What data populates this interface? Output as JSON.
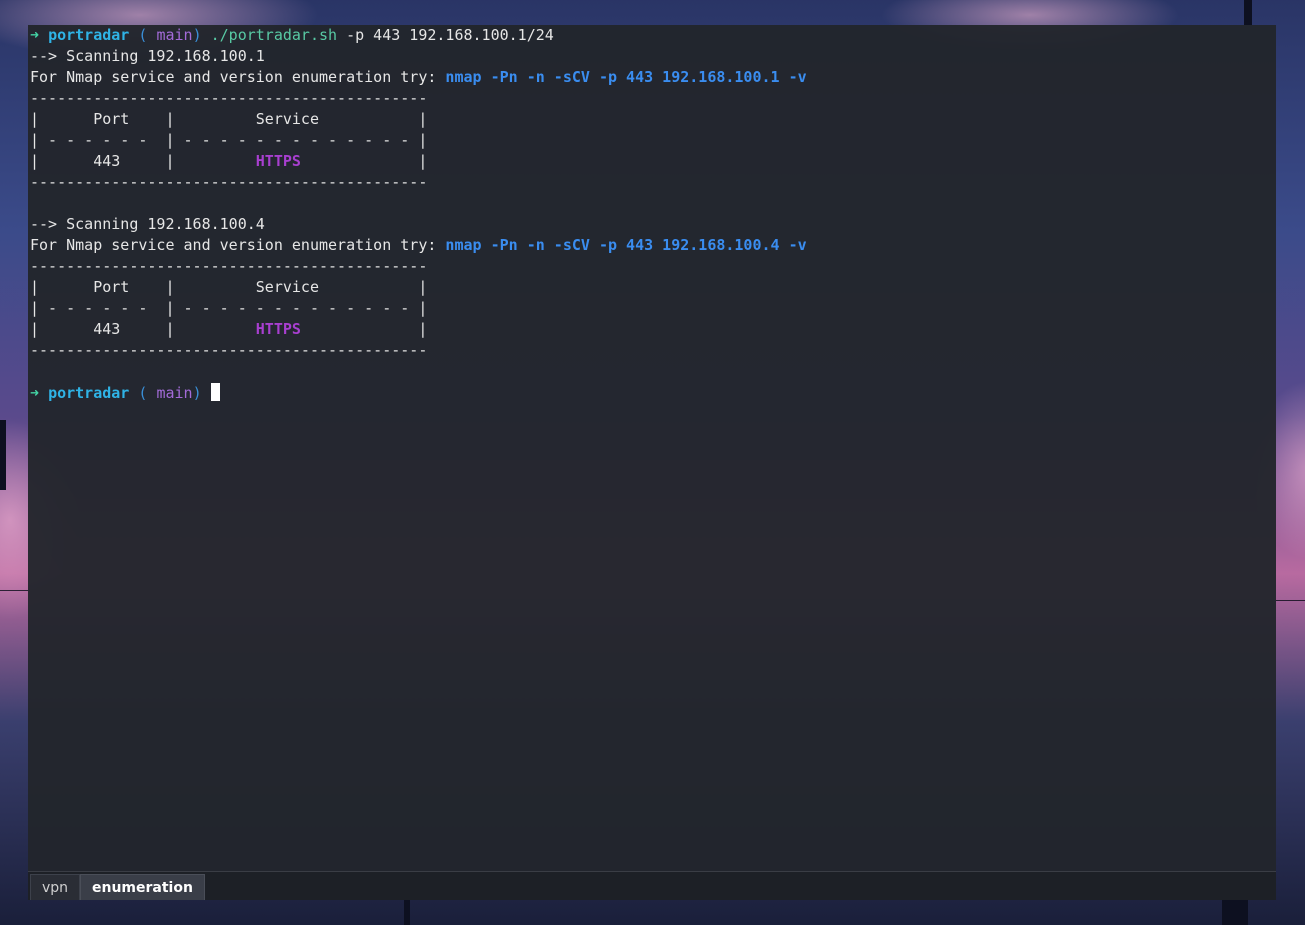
{
  "terminal": {
    "lines": {
      "l1": {
        "arrow": "➜",
        "dir": "portradar",
        "paren_open": "(",
        "branch_icon": "",
        "branch": "main",
        "paren_close": ")",
        "cmd": "./portradar.sh",
        "args": " -p 443 192.168.100.1/24"
      },
      "l2": "--> Scanning 192.168.100.1",
      "l3": {
        "prefix": "For Nmap service and version enumeration try: ",
        "cmd": "nmap -Pn -n -sCV -p 443 192.168.100.1 -v"
      },
      "l4": "--------------------------------------------",
      "l5": "|      Port    |         Service           |",
      "l6": "| - - - - - -  | - - - - - - - - - - - - - |",
      "l7": {
        "left": "|      443     |         ",
        "service": "HTTPS",
        "right": "             |"
      },
      "l8": "--------------------------------------------",
      "l10": "--> Scanning 192.168.100.4",
      "l11": {
        "prefix": "For Nmap service and version enumeration try: ",
        "cmd": "nmap -Pn -n -sCV -p 443 192.168.100.4 -v"
      },
      "l12": "--------------------------------------------",
      "l13": "|      Port    |         Service           |",
      "l14": "| - - - - - -  | - - - - - - - - - - - - - |",
      "l15": {
        "left": "|      443     |         ",
        "service": "HTTPS",
        "right": "             |"
      },
      "l16": "--------------------------------------------",
      "l18": {
        "arrow": "➜",
        "dir": "portradar",
        "paren_open": "(",
        "branch_icon": "",
        "branch": "main",
        "paren_close": ")"
      }
    }
  },
  "tabs": [
    {
      "label": "vpn",
      "active": false
    },
    {
      "label": "enumeration",
      "active": true
    }
  ],
  "colors": {
    "prompt_dir": "#2fb3e6",
    "branch": "#a36bd8",
    "nmap_cmd": "#3a8df0",
    "service": "#a83fd0",
    "terminal_bg": "#22252c"
  }
}
